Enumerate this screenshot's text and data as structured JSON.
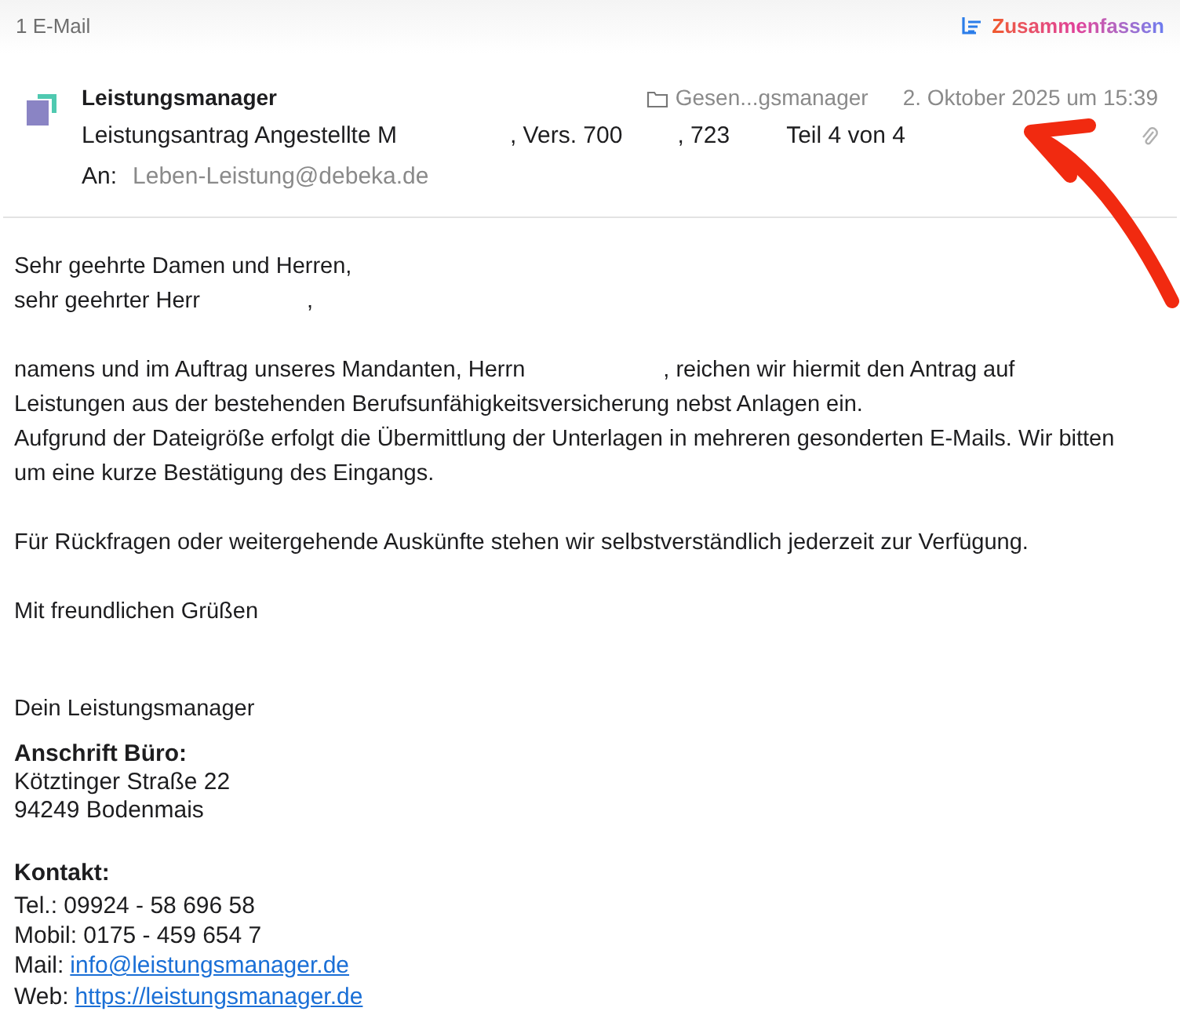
{
  "toolbar": {
    "count": "1 E-Mail",
    "summarize": "Zusammenfassen"
  },
  "message": {
    "sender": "Leistungsmanager",
    "folder": "Gesen...gsmanager",
    "date": "2. Oktober 2025 um 15:39",
    "subject_parts": [
      "Leistungsantrag Angestellte M",
      ", Vers. 700",
      ", 723",
      "Teil 4 von 4"
    ],
    "to_label": "An:",
    "to": "Leben-Leistung@debeka.de",
    "has_attachment": true
  },
  "body": {
    "greeting": [
      "Sehr geehrte Damen und Herren,"
    ],
    "greeting_parts": [
      "sehr geehrter Herr",
      ","
    ],
    "paragraph_parts": [
      "namens und im Auftrag unseres Mandanten, Herrn",
      ", reichen wir hiermit den Antrag auf Leistungen aus der bestehenden Berufsunfähigkeitsversicherung nebst Anlagen ein."
    ],
    "paragraph2": "Aufgrund der Dateigröße erfolgt die Übermittlung der Unterlagen in mehreren gesonderten E-Mails. Wir bitten um eine kurze Bestätigung des Eingangs.",
    "paragraph3": "Für Rückfragen oder weitergehende Auskünfte stehen wir selbstverständlich jederzeit zur Verfügung.",
    "closing": "Mit freundlichen Grüßen",
    "signature": "Dein Leistungsmanager"
  },
  "address": {
    "heading": "Anschrift Büro:",
    "lines": [
      "Kötztinger Straße 22",
      "94249 Bodenmais"
    ]
  },
  "contact": {
    "heading": "Kontakt:",
    "lines": [
      {
        "kind": "text",
        "text": "Tel.: 09924 - 58 696 58"
      },
      {
        "kind": "text",
        "text": "Mobil: 0175 - 459 654 7"
      },
      {
        "kind": "link",
        "label": "Mail:",
        "text": "info@leistungsmanager.de"
      },
      {
        "kind": "link",
        "label": "Web:",
        "text": "https://leistungsmanager.de"
      }
    ]
  }
}
